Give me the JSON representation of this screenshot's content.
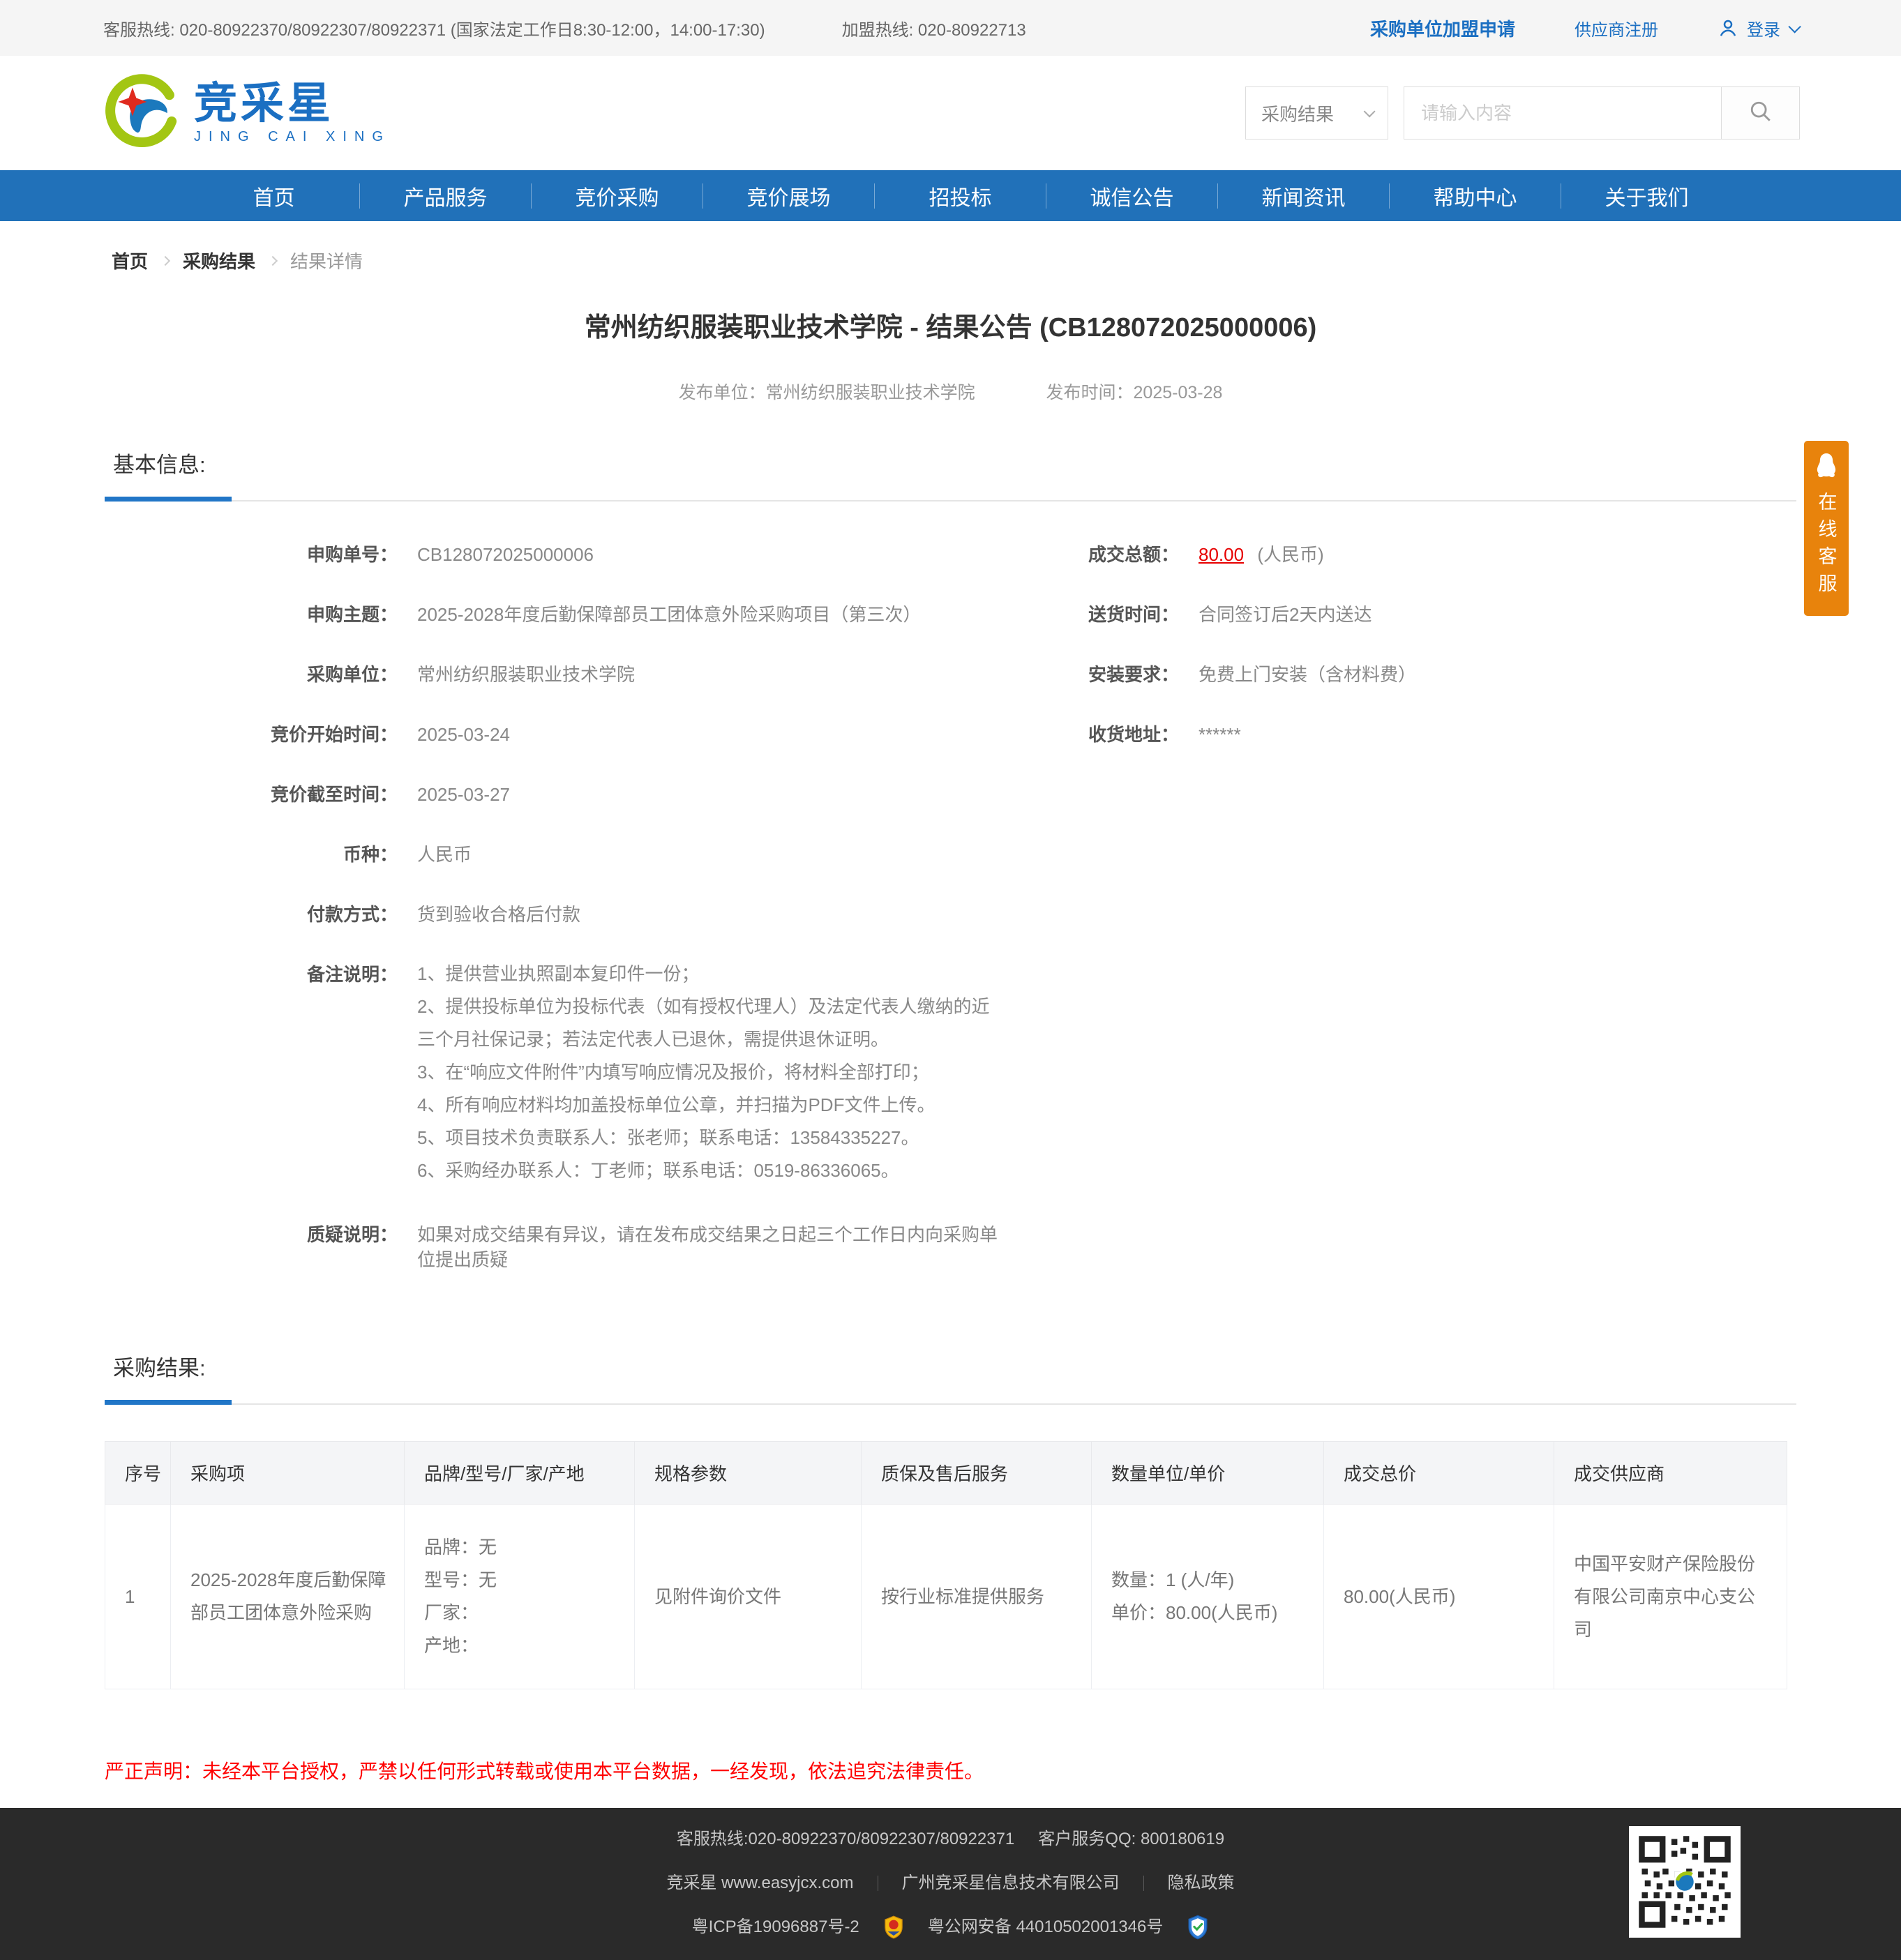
{
  "topbar": {
    "service_hotline": "客服热线: 020-80922370/80922307/80922371 (国家法定工作日8:30-12:00，14:00-17:30)",
    "join_hotline": "加盟热线: 020-80922713",
    "purchaser_apply": "采购单位加盟申请",
    "supplier_register": "供应商注册",
    "login": "登录"
  },
  "header": {
    "logo_text": "竞采星",
    "logo_subtext": "JING CAI XING",
    "search_category": "采购结果",
    "search_placeholder": "请输入内容"
  },
  "nav": {
    "items": [
      "首页",
      "产品服务",
      "竞价采购",
      "竞价展场",
      "招投标",
      "诚信公告",
      "新闻资讯",
      "帮助中心",
      "关于我们"
    ]
  },
  "breadcrumb": {
    "items": [
      "首页",
      "采购结果",
      "结果详情"
    ]
  },
  "page": {
    "title": "常州纺织服装职业技术学院 - 结果公告 (CB128072025000006)",
    "publisher": "发布单位：常州纺织服装职业技术学院",
    "publish_time": "发布时间：2025-03-28"
  },
  "basic_info": {
    "section_title": "基本信息:",
    "fields_left": [
      {
        "label": "申购单号：",
        "value": "CB128072025000006"
      },
      {
        "label": "申购主题：",
        "value": "2025-2028年度后勤保障部员工团体意外险采购项目（第三次）"
      },
      {
        "label": "采购单位：",
        "value": "常州纺织服装职业技术学院"
      },
      {
        "label": "竞价开始时间：",
        "value": "2025-03-24"
      },
      {
        "label": "竞价截至时间：",
        "value": "2025-03-27"
      },
      {
        "label": "币种：",
        "value": "人民币"
      },
      {
        "label": "付款方式：",
        "value": "货到验收合格后付款"
      }
    ],
    "remark": {
      "label": "备注说明：",
      "value": "1、提供营业执照副本复印件一份；\n2、提供投标单位为投标代表（如有授权代理人）及法定代表人缴纳的近三个月社保记录；若法定代表人已退休，需提供退休证明。\n3、在“响应文件附件”内填写响应情况及报价，将材料全部打印；\n4、所有响应材料均加盖投标单位公章，并扫描为PDF文件上传。\n5、项目技术负责联系人：张老师；联系电话：13584335227。\n6、采购经办联系人：丁老师；联系电话：0519-86336065。"
    },
    "question": {
      "label": "质疑说明：",
      "value": "如果对成交结果有异议，请在发布成交结果之日起三个工作日内向采购单位提出质疑"
    },
    "deal_total": {
      "label": "成交总额：",
      "amount": "80.00",
      "suffix": "(人民币)"
    },
    "fields_right": [
      {
        "label": "送货时间：",
        "value": "合同签订后2天内送达"
      },
      {
        "label": "安装要求：",
        "value": "免费上门安装（含材料费）"
      },
      {
        "label": "收货地址：",
        "value": "******"
      }
    ]
  },
  "result": {
    "section_title": "采购结果:",
    "headers": [
      "序号",
      "采购项",
      "品牌/型号/厂家/产地",
      "规格参数",
      "质保及售后服务",
      "数量单位/单价",
      "成交总价",
      "成交供应商"
    ],
    "row": {
      "no": "1",
      "item": "2025-2028年度后勤保障部员工团体意外险采购",
      "brand": "品牌：无\n型号：无\n厂家：\n产地：",
      "spec": "见附件询价文件",
      "service": "按行业标准提供服务",
      "qty": "数量：1 (人/年)\n单价：80.00(人民币)",
      "total": "80.00(人民币)",
      "supplier": "中国平安财产保险股份有限公司南京中心支公司"
    }
  },
  "statement": "严正声明：未经本平台授权，严禁以任何形式转载或使用本平台数据，一经发现，依法追究法律责任。",
  "online_service": {
    "label": "在线客服"
  },
  "footer": {
    "hotline": "客服热线:020-80922370/80922307/80922371",
    "qq": "客户服务QQ: 800180619",
    "brand": "竞采星 www.easyjcx.com",
    "company": "广州竞采星信息技术有限公司",
    "privacy": "隐私政策",
    "icp": "粤ICP备19096887号-2",
    "security": "粤公网安备 44010502001346号"
  },
  "colors": {
    "nav_blue": "#2171b9",
    "link_blue": "#1b6fc2",
    "accent_orange": "#e8830c",
    "alert_red": "#ff0000",
    "amount_red": "#e60000"
  }
}
